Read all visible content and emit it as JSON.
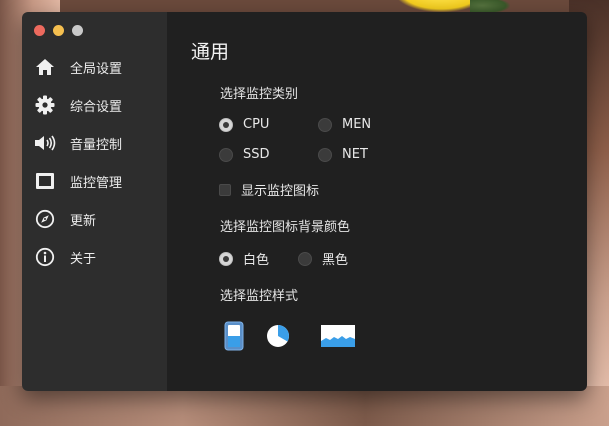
{
  "window": {
    "controls": [
      "close",
      "minimize",
      "zoom"
    ]
  },
  "sidebar": {
    "items": [
      {
        "label": "全局设置",
        "icon": "home-icon"
      },
      {
        "label": "综合设置",
        "icon": "gear-icon"
      },
      {
        "label": "音量控制",
        "icon": "speaker-icon"
      },
      {
        "label": "监控管理",
        "icon": "monitor-icon"
      },
      {
        "label": "更新",
        "icon": "compass-icon"
      },
      {
        "label": "关于",
        "icon": "info-icon"
      }
    ]
  },
  "main": {
    "title": "通用",
    "monitor_type": {
      "label": "选择监控类别",
      "options": [
        "CPU",
        "MEN",
        "SSD",
        "NET"
      ],
      "selected": "CPU"
    },
    "show_icon": {
      "label": "显示监控图标",
      "checked": false
    },
    "bg_color": {
      "label": "选择监控图标背景颜色",
      "options": [
        "白色",
        "黑色"
      ],
      "selected": "白色"
    },
    "monitor_style": {
      "label": "选择监控样式",
      "options": [
        "bar-style-icon",
        "pie-style-icon",
        "wave-style-icon"
      ],
      "selected": "bar-style-icon"
    }
  },
  "colors": {
    "accent_blue": "#3a9ee8",
    "sidebar_bg": "#2d2d2d",
    "main_bg": "#202020"
  }
}
